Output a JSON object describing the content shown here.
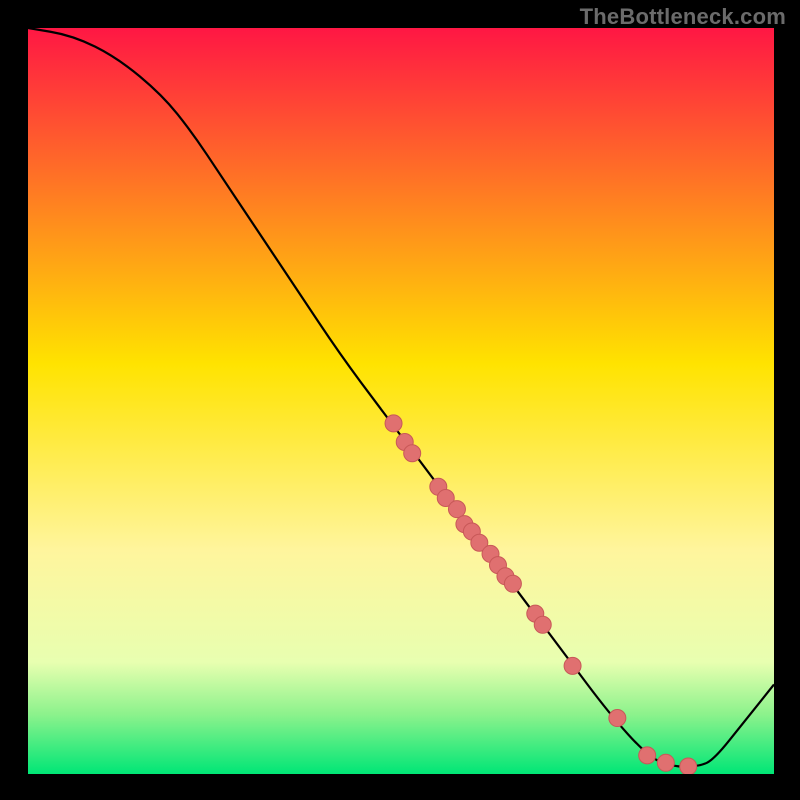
{
  "watermark": "TheBottleneck.com",
  "chart_data": {
    "type": "line",
    "title": "",
    "xlabel": "",
    "ylabel": "",
    "xlim": [
      0,
      100
    ],
    "ylim": [
      0,
      100
    ],
    "grid": false,
    "legend": false,
    "curve": [
      {
        "x": 0.0,
        "y": 100.0
      },
      {
        "x": 6.0,
        "y": 99.0
      },
      {
        "x": 12.0,
        "y": 96.0
      },
      {
        "x": 18.0,
        "y": 91.0
      },
      {
        "x": 22.0,
        "y": 86.0
      },
      {
        "x": 26.0,
        "y": 80.0
      },
      {
        "x": 30.0,
        "y": 74.0
      },
      {
        "x": 36.0,
        "y": 65.0
      },
      {
        "x": 42.0,
        "y": 56.0
      },
      {
        "x": 48.0,
        "y": 48.0
      },
      {
        "x": 54.0,
        "y": 40.0
      },
      {
        "x": 60.0,
        "y": 32.0
      },
      {
        "x": 66.0,
        "y": 24.0
      },
      {
        "x": 72.0,
        "y": 16.0
      },
      {
        "x": 78.0,
        "y": 8.0
      },
      {
        "x": 83.0,
        "y": 2.5
      },
      {
        "x": 86.0,
        "y": 1.0
      },
      {
        "x": 90.0,
        "y": 1.0
      },
      {
        "x": 92.0,
        "y": 2.0
      },
      {
        "x": 96.0,
        "y": 7.0
      },
      {
        "x": 100.0,
        "y": 12.0
      }
    ],
    "points": [
      {
        "x": 49.0,
        "y": 47.0
      },
      {
        "x": 50.5,
        "y": 44.5
      },
      {
        "x": 51.5,
        "y": 43.0
      },
      {
        "x": 55.0,
        "y": 38.5
      },
      {
        "x": 56.0,
        "y": 37.0
      },
      {
        "x": 57.5,
        "y": 35.5
      },
      {
        "x": 58.5,
        "y": 33.5
      },
      {
        "x": 59.5,
        "y": 32.5
      },
      {
        "x": 60.5,
        "y": 31.0
      },
      {
        "x": 62.0,
        "y": 29.5
      },
      {
        "x": 63.0,
        "y": 28.0
      },
      {
        "x": 64.0,
        "y": 26.5
      },
      {
        "x": 65.0,
        "y": 25.5
      },
      {
        "x": 68.0,
        "y": 21.5
      },
      {
        "x": 69.0,
        "y": 20.0
      },
      {
        "x": 73.0,
        "y": 14.5
      },
      {
        "x": 79.0,
        "y": 7.5
      },
      {
        "x": 83.0,
        "y": 2.5
      },
      {
        "x": 85.5,
        "y": 1.5
      },
      {
        "x": 88.5,
        "y": 1.0
      }
    ],
    "gradient_stops": [
      {
        "offset": 0.0,
        "color": "#ff1744"
      },
      {
        "offset": 0.45,
        "color": "#ffe300"
      },
      {
        "offset": 0.7,
        "color": "#fff59d"
      },
      {
        "offset": 0.85,
        "color": "#e8ffb0"
      },
      {
        "offset": 0.92,
        "color": "#8cf28c"
      },
      {
        "offset": 1.0,
        "color": "#00e676"
      }
    ],
    "colors": {
      "curve": "#000000",
      "point_fill": "#e07070",
      "point_stroke": "#c85858"
    }
  }
}
